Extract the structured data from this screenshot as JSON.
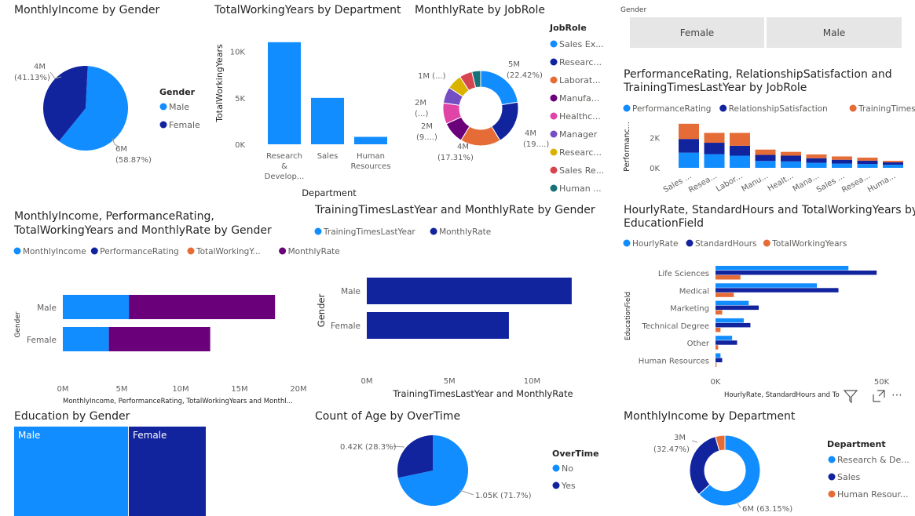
{
  "colors": {
    "light_blue": "#118dff",
    "dark_blue": "#12239e",
    "orange": "#e66c37",
    "purple": "#6b007b",
    "violet": "#744ec2",
    "magenta": "#e044a7",
    "yellow": "#d9b300",
    "red": "#d64550",
    "teal": "#197278"
  },
  "slicer": {
    "title": "Gender",
    "options": [
      "Female",
      "Male"
    ]
  },
  "charts": {
    "c1": {
      "title": "MonthlyIncome by Gender",
      "legend_title": "Gender",
      "legend": [
        "Male",
        "Female"
      ],
      "chart_data": {
        "type": "pie",
        "slices": [
          {
            "name": "Male",
            "value": 6,
            "label1": "6M",
            "label2": "(58.87%)",
            "color": "#118dff"
          },
          {
            "name": "Female",
            "value": 4,
            "label1": "4M",
            "label2": "(41.13%)",
            "color": "#12239e"
          }
        ]
      }
    },
    "c2": {
      "title": "TotalWorkingYears by Department",
      "ylabel": "TotalWorkingYears",
      "xlabel": "Department",
      "yticks": [
        "0K",
        "5K",
        "10K"
      ],
      "chart_data": {
        "type": "bar",
        "categories": [
          "Research & Develop...",
          "Sales",
          "Human Resources"
        ],
        "category_lines": [
          [
            "Research",
            "&",
            "Develop..."
          ],
          [
            "Sales"
          ],
          [
            "Human",
            "Resources"
          ]
        ],
        "values": [
          11000,
          5000,
          800
        ],
        "ylim": [
          0,
          12000
        ]
      }
    },
    "c3": {
      "title": "MonthlyRate by JobRole",
      "legend_title": "JobRole",
      "legend": [
        "Sales Ex...",
        "Researc...",
        "Laborat...",
        "Manufa...",
        "Healthc...",
        "Manager",
        "Researc...",
        "Sales Re...",
        "Human ..."
      ],
      "chart_data": {
        "type": "donut",
        "values": [
          22.42,
          19.0,
          17.31,
          9.5,
          9.0,
          7.0,
          6.5,
          5.5,
          3.77
        ],
        "colors": [
          "#118dff",
          "#12239e",
          "#e66c37",
          "#6b007b",
          "#e044a7",
          "#744ec2",
          "#d9b300",
          "#d64550",
          "#197278"
        ],
        "labels": [
          "5M (22.42%)",
          "4M (19....)",
          "4M (17.31%)",
          "2M (9....)",
          "2M (...)",
          "1M (...)"
        ]
      }
    },
    "c4": {
      "title_lines": [
        "PerformanceRating, RelationshipSatisfaction and",
        "TrainingTimesLastYear by JobRole"
      ],
      "legend": [
        "PerformanceRating",
        "RelationshipSatisfaction",
        "TrainingTimesLastYear"
      ],
      "ylabel": "Performanc...",
      "yticks": [
        "0K",
        "2K"
      ],
      "chart_data": {
        "type": "bar",
        "stacked": true,
        "categories": [
          "Sales ...",
          "Resea...",
          "Labor...",
          "Manu...",
          "Healt...",
          "Mana...",
          "Sales ...",
          "Resea...",
          "Huma..."
        ],
        "series": [
          {
            "name": "PerformanceRating",
            "values": [
              1000,
              900,
              800,
              450,
              420,
              330,
              280,
              250,
              200
            ]
          },
          {
            "name": "RelationshipSatisfaction",
            "values": [
              900,
              750,
              650,
              400,
              380,
              300,
              250,
              220,
              160
            ]
          },
          {
            "name": "TrainingTimesLastYear",
            "values": [
              1000,
              650,
              850,
              350,
              250,
              250,
              220,
              200,
              100
            ]
          }
        ],
        "ylim": [
          0,
          3200
        ]
      }
    },
    "c5": {
      "title_lines": [
        "MonthlyIncome, PerformanceRating,",
        "TotalWorkingYears and MonthlyRate by Gender"
      ],
      "legend": [
        "MonthlyIncome",
        "PerformanceRating",
        "TotalWorkingY...",
        "MonthlyRate"
      ],
      "ylabel": "Gender",
      "xlabel": "MonthlyIncome, PerformanceRating, TotalWorkingYears and Monthl...",
      "xticks": [
        "0M",
        "5M",
        "10M",
        "15M",
        "20M"
      ],
      "chart_data": {
        "type": "bar",
        "orientation": "horizontal",
        "stacked": true,
        "categories": [
          "Male",
          "Female"
        ],
        "series": [
          {
            "name": "MonthlyIncome",
            "values": [
              5.6,
              3.9
            ]
          },
          {
            "name": "PerformanceRating",
            "values": [
              0.005,
              0.004
            ]
          },
          {
            "name": "TotalWorkingYears",
            "values": [
              0.006,
              0.005
            ]
          },
          {
            "name": "MonthlyRate",
            "values": [
              12.4,
              8.6
            ]
          }
        ],
        "xlim": [
          0,
          20
        ]
      }
    },
    "c6": {
      "title": "TrainingTimesLastYear and MonthlyRate by Gender",
      "legend": [
        "TrainingTimesLastYear",
        "MonthlyRate"
      ],
      "ylabel": "Gender",
      "xlabel": "TrainingTimesLastYear and MonthlyRate",
      "xticks": [
        "0M",
        "5M",
        "10M"
      ],
      "chart_data": {
        "type": "bar",
        "orientation": "horizontal",
        "categories": [
          "Male",
          "Female"
        ],
        "series": [
          {
            "name": "TrainingTimesLastYear",
            "values": [
              0.0012,
              0.0008
            ]
          },
          {
            "name": "MonthlyRate",
            "values": [
              12.4,
              8.6
            ]
          }
        ],
        "xlim": [
          0,
          12.5
        ]
      }
    },
    "c7": {
      "title_lines": [
        "HourlyRate, StandardHours and TotalWorkingYears by",
        "EducationField"
      ],
      "legend": [
        "HourlyRate",
        "StandardHours",
        "TotalWorkingYears"
      ],
      "ylabel": "EducationField",
      "xlabel": "HourlyRate, StandardHours and To",
      "xticks": [
        "0K",
        "50K"
      ],
      "chart_data": {
        "type": "bar",
        "orientation": "horizontal",
        "categories": [
          "Life Sciences",
          "Medical",
          "Marketing",
          "Technical Degree",
          "Other",
          "Human Resources"
        ],
        "series": [
          {
            "name": "HourlyRate",
            "values": [
              40000,
              30500,
              10000,
              8500,
              5000,
              1500
            ]
          },
          {
            "name": "StandardHours",
            "values": [
              48500,
              37000,
              13000,
              10500,
              6500,
              2000
            ]
          },
          {
            "name": "TotalWorkingYears",
            "values": [
              7500,
              5500,
              2000,
              1500,
              800,
              300
            ]
          }
        ],
        "xlim": [
          0,
          52000
        ]
      }
    },
    "c8": {
      "title": "Education by Gender",
      "chart_data": {
        "type": "treemap",
        "items": [
          {
            "name": "Male",
            "value": 58.87
          },
          {
            "name": "Female",
            "value": 41.13
          }
        ]
      }
    },
    "c9": {
      "title": "Count of Age by OverTime",
      "legend_title": "OverTime",
      "legend": [
        "No",
        "Yes"
      ],
      "chart_data": {
        "type": "pie",
        "slices": [
          {
            "name": "No",
            "value": 71.7,
            "label": "1.05K (71.7%)",
            "color": "#118dff"
          },
          {
            "name": "Yes",
            "value": 28.3,
            "label": "0.42K (28.3%)",
            "color": "#12239e"
          }
        ]
      }
    },
    "c10": {
      "title": "MonthlyIncome by Department",
      "legend_title": "Department",
      "legend": [
        "Research & De...",
        "Sales",
        "Human Resour..."
      ],
      "chart_data": {
        "type": "donut",
        "slices": [
          {
            "name": "Research & Development",
            "value": 63.15,
            "label1": "6M",
            "label2": "(63.15%)",
            "color": "#118dff"
          },
          {
            "name": "Sales",
            "value": 32.47,
            "label1": "3M",
            "label2": "(32.47%)",
            "color": "#12239e"
          },
          {
            "name": "Human Resources",
            "value": 4.38,
            "color": "#e66c37"
          }
        ]
      }
    }
  }
}
